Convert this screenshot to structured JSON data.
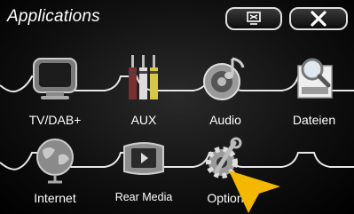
{
  "header": {
    "title": "Applications",
    "keyboard_icon": "keyboard-hide-icon",
    "close_icon": "close-icon"
  },
  "apps": [
    {
      "label": "TV/DAB+",
      "icon": "tv-icon"
    },
    {
      "label": "AUX",
      "icon": "aux-cable-icon"
    },
    {
      "label": "Audio",
      "icon": "speaker-music-icon"
    },
    {
      "label": "Dateien",
      "icon": "file-search-icon"
    },
    {
      "label": "Internet",
      "icon": "globe-icon"
    },
    {
      "label": "Rear Media",
      "icon": "rear-media-icon"
    },
    {
      "label": "Option",
      "icon": "settings-icon"
    }
  ],
  "colors": {
    "accent": "#f5b800",
    "tile_outline": "#e8e8e8",
    "background": "#000000"
  }
}
